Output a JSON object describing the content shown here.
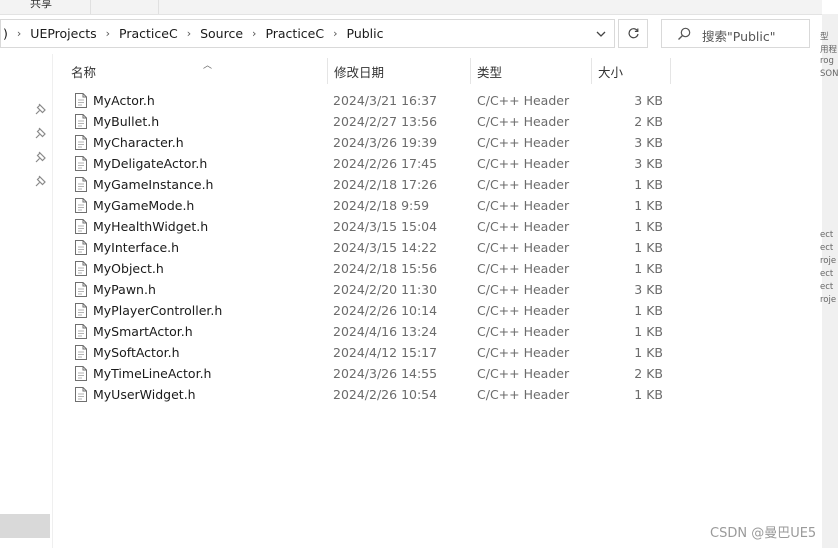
{
  "ribbon": {
    "share_tab": "共享"
  },
  "address": {
    "crumbs": [
      "UEProjects",
      "PracticeC",
      "Source",
      "PracticeC",
      "Public"
    ],
    "lead_fragment": ")"
  },
  "search": {
    "placeholder": "搜索\"Public\""
  },
  "columns": {
    "name": "名称",
    "date": "修改日期",
    "type": "类型",
    "size": "大小"
  },
  "files": [
    {
      "name": "MyActor.h",
      "date": "2024/3/21 16:37",
      "type": "C/C++ Header",
      "size": "3 KB"
    },
    {
      "name": "MyBullet.h",
      "date": "2024/2/27 13:56",
      "type": "C/C++ Header",
      "size": "2 KB"
    },
    {
      "name": "MyCharacter.h",
      "date": "2024/3/26 19:39",
      "type": "C/C++ Header",
      "size": "3 KB"
    },
    {
      "name": "MyDeligateActor.h",
      "date": "2024/2/26 17:45",
      "type": "C/C++ Header",
      "size": "3 KB"
    },
    {
      "name": "MyGameInstance.h",
      "date": "2024/2/18 17:26",
      "type": "C/C++ Header",
      "size": "1 KB"
    },
    {
      "name": "MyGameMode.h",
      "date": "2024/2/18 9:59",
      "type": "C/C++ Header",
      "size": "1 KB"
    },
    {
      "name": "MyHealthWidget.h",
      "date": "2024/3/15 15:04",
      "type": "C/C++ Header",
      "size": "1 KB"
    },
    {
      "name": "MyInterface.h",
      "date": "2024/3/15 14:22",
      "type": "C/C++ Header",
      "size": "1 KB"
    },
    {
      "name": "MyObject.h",
      "date": "2024/2/18 15:56",
      "type": "C/C++ Header",
      "size": "1 KB"
    },
    {
      "name": "MyPawn.h",
      "date": "2024/2/20 11:30",
      "type": "C/C++ Header",
      "size": "3 KB"
    },
    {
      "name": "MyPlayerController.h",
      "date": "2024/2/26 10:14",
      "type": "C/C++ Header",
      "size": "1 KB"
    },
    {
      "name": "MySmartActor.h",
      "date": "2024/4/16 13:24",
      "type": "C/C++ Header",
      "size": "1 KB"
    },
    {
      "name": "MySoftActor.h",
      "date": "2024/4/12 15:17",
      "type": "C/C++ Header",
      "size": "1 KB"
    },
    {
      "name": "MyTimeLineActor.h",
      "date": "2024/3/26 14:55",
      "type": "C/C++ Header",
      "size": "2 KB"
    },
    {
      "name": "MyUserWidget.h",
      "date": "2024/2/26 10:54",
      "type": "C/C++ Header",
      "size": "1 KB"
    }
  ],
  "right_peek": [
    "型",
    "用程",
    "rog",
    "SON",
    "ect",
    "ect",
    "roje",
    "ect",
    "ect",
    "roje"
  ],
  "watermark": "CSDN @曼巴UE5",
  "icons": {
    "dropdown": "chevron-down-icon",
    "refresh": "refresh-icon",
    "search": "search-icon",
    "pin": "pin-icon",
    "file": "header-file-icon",
    "sort": "sort-up-icon"
  },
  "colors": {
    "header_text": "#333333",
    "meta_text": "#6b6b6b",
    "pane_border": "#d9d9d9"
  }
}
